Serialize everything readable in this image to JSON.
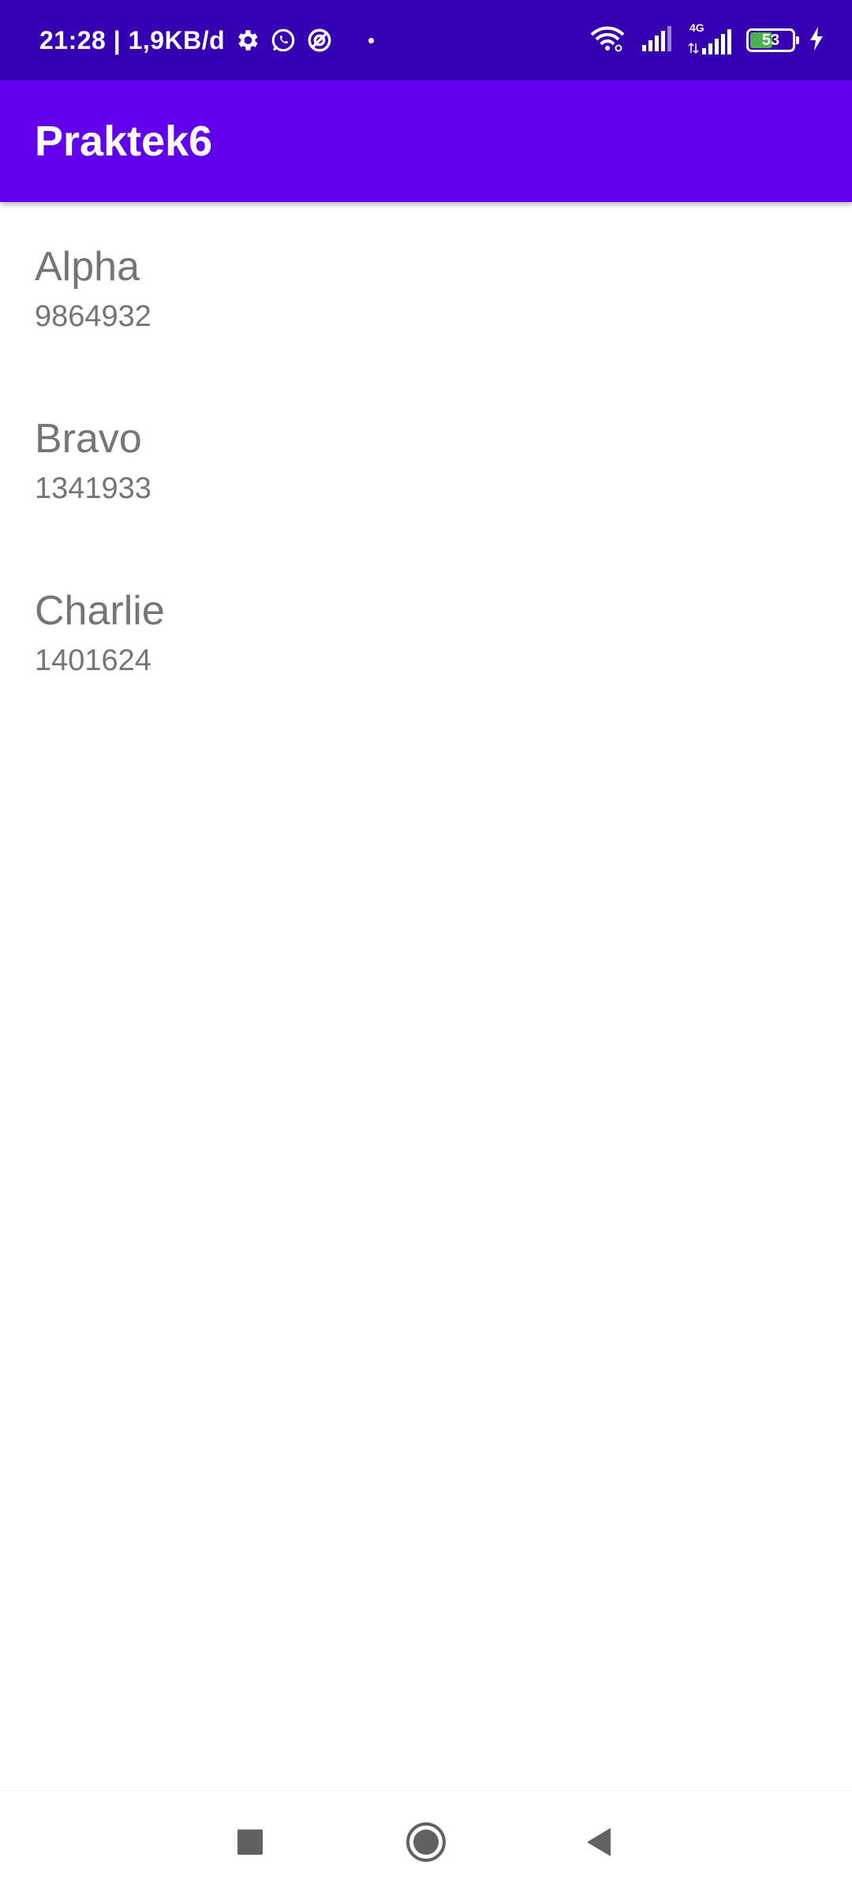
{
  "status_bar": {
    "time_and_speed": "21:28 | 1,9KB/d",
    "battery_level": "53",
    "network_type": "4G",
    "icons": [
      "settings-icon",
      "whatsapp-icon",
      "vpn-icon",
      "notification-dot-icon",
      "wifi-icon",
      "signal-icon",
      "signal-4g-icon",
      "battery-icon",
      "charging-icon"
    ],
    "background": "#3700b3",
    "battery_fill_color": "#4caf50"
  },
  "app_bar": {
    "title": "Praktek6",
    "background": "#6200ee"
  },
  "contacts": [
    {
      "name": "Alpha",
      "number": "9864932"
    },
    {
      "name": "Bravo",
      "number": "1341933"
    },
    {
      "name": "Charlie",
      "number": "1401624"
    }
  ],
  "nav_bar": {
    "buttons": [
      "recents-square-icon",
      "home-circle-icon",
      "back-triangle-icon"
    ]
  }
}
